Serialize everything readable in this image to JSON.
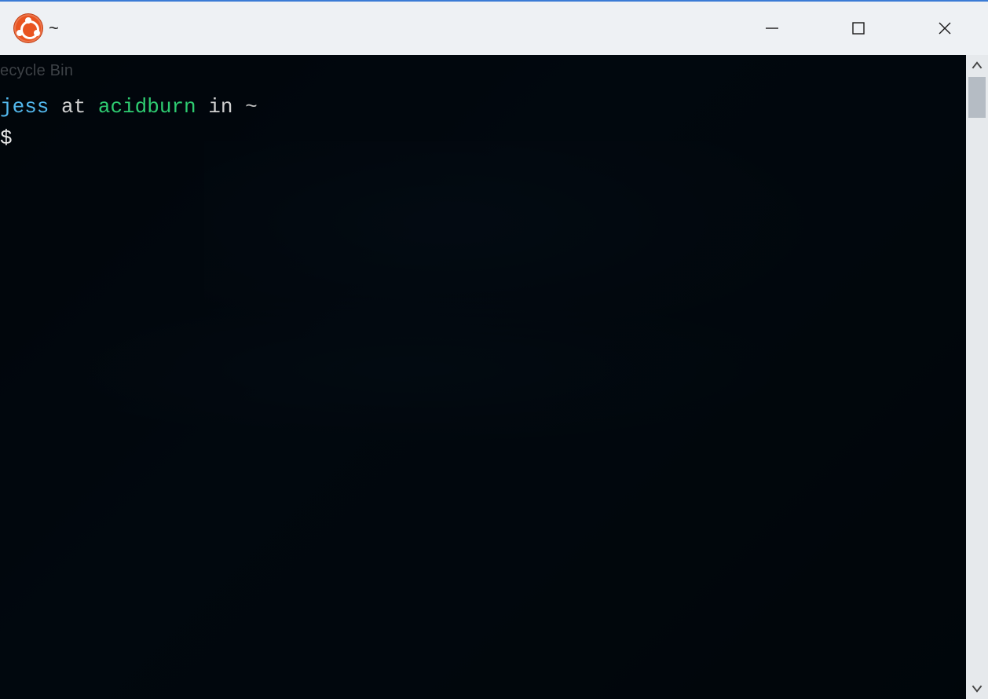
{
  "desktop": {
    "recycle_bin_label": "ecycle Bin"
  },
  "window": {
    "app_icon_name": "ubuntu-logo",
    "title": "~",
    "controls": {
      "minimize_name": "minimize-icon",
      "maximize_name": "maximize-icon",
      "close_name": "close-icon"
    }
  },
  "terminal": {
    "ps1": {
      "user": "jess",
      "at": " at ",
      "host": "acidburn",
      "in": " in ",
      "path": "~"
    },
    "prompt": "$",
    "input_value": ""
  },
  "scrollbar": {
    "up_name": "scroll-up-icon",
    "down_name": "scroll-down-icon"
  },
  "colors": {
    "titlebar_bg": "#eef1f4",
    "accent_top_border": "#3a7bd5",
    "terminal_bg": "rgba(0,4,9,0.72)",
    "ps1_user": "#53b8ed",
    "ps1_host": "#2ecc71",
    "ubuntu_orange": "#e95420"
  }
}
